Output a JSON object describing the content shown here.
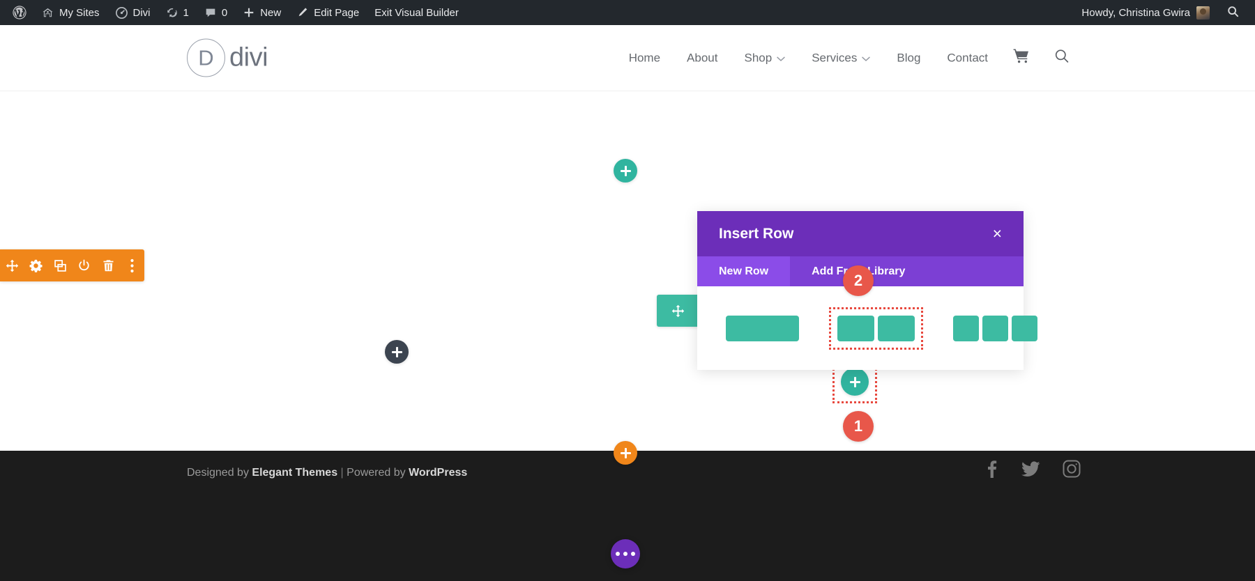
{
  "adminbar": {
    "items": [
      {
        "name": "wordpress-logo",
        "icon": "wordpress-icon",
        "label": ""
      },
      {
        "name": "my-sites",
        "icon": "sites-icon",
        "label": "My Sites"
      },
      {
        "name": "divi",
        "icon": "divi-speedometer-icon",
        "label": "Divi"
      },
      {
        "name": "updates",
        "icon": "updates-icon",
        "label": "1"
      },
      {
        "name": "comments",
        "icon": "comment-bubble-icon",
        "label": "0"
      },
      {
        "name": "new",
        "icon": "plus-icon",
        "label": "New"
      },
      {
        "name": "edit-page",
        "icon": "pencil-icon",
        "label": "Edit Page"
      },
      {
        "name": "exit-visual-builder",
        "icon": "",
        "label": "Exit Visual Builder"
      }
    ],
    "howdy": "Howdy, Christina Gwira",
    "search_icon": "search-icon"
  },
  "siteheader": {
    "logo_letter": "D",
    "logo_text": "divi",
    "nav": [
      {
        "label": "Home",
        "has_caret": false
      },
      {
        "label": "About",
        "has_caret": false
      },
      {
        "label": "Shop",
        "has_caret": true
      },
      {
        "label": "Services",
        "has_caret": true
      },
      {
        "label": "Blog",
        "has_caret": false
      },
      {
        "label": "Contact",
        "has_caret": false
      }
    ],
    "cart_icon": "shopping-cart-icon",
    "search_icon": "search-icon"
  },
  "modal": {
    "title": "Insert Row",
    "close_label": "×",
    "tabs": [
      {
        "label": "New Row",
        "active": true
      },
      {
        "label": "Add From Library",
        "active": false
      }
    ],
    "layouts": [
      {
        "name": "one-column",
        "columns": 1,
        "selected": false
      },
      {
        "name": "two-column",
        "columns": 2,
        "selected": true
      },
      {
        "name": "three-column",
        "columns": 3,
        "selected": false
      }
    ],
    "accent_purple": "#6c2eb9",
    "tab_purple": "#7c3fd4",
    "tab_active_purple": "#8b4ce8",
    "column_green": "#3dbba2"
  },
  "annotations": {
    "badge_1": "1",
    "badge_2": "2",
    "badge_color": "#e8574a",
    "highlight_color": "#e8493f"
  },
  "builder": {
    "add_section_top": {
      "name": "add-section-top-button",
      "color": "#30b49f"
    },
    "add_row_mid": {
      "name": "add-row-button",
      "color": "#3c4450"
    },
    "add_section_bottom": {
      "name": "add-section-bottom-button",
      "color": "#f0861a"
    },
    "add_row_modal": {
      "name": "add-row-green-button",
      "color": "#30b49f"
    },
    "page_settings": {
      "name": "page-settings-button",
      "color": "#6c2eb9"
    },
    "section_toolbar": {
      "color": "#f0861a",
      "buttons": [
        {
          "name": "move-section-icon",
          "icon": "move-arrows-icon"
        },
        {
          "name": "section-settings-icon",
          "icon": "gear-icon"
        },
        {
          "name": "duplicate-section-icon",
          "icon": "duplicate-icon"
        },
        {
          "name": "disable-section-icon",
          "icon": "power-icon"
        },
        {
          "name": "delete-section-icon",
          "icon": "trash-icon"
        },
        {
          "name": "more-options-icon",
          "icon": "ellipsis-vertical-icon"
        }
      ]
    },
    "row_toolbar": {
      "color": "#3dbba2",
      "buttons": [
        {
          "name": "move-row-icon",
          "icon": "move-arrows-icon"
        },
        {
          "name": "row-settings-icon",
          "icon": "gear-icon"
        }
      ]
    }
  },
  "footer": {
    "credit_prefix": "Designed by ",
    "credit_brand": "Elegant Themes",
    "credit_separator": " | ",
    "credit_powered": "Powered by ",
    "credit_platform": "WordPress",
    "social": [
      {
        "name": "facebook-icon"
      },
      {
        "name": "twitter-icon"
      },
      {
        "name": "instagram-icon"
      }
    ]
  }
}
